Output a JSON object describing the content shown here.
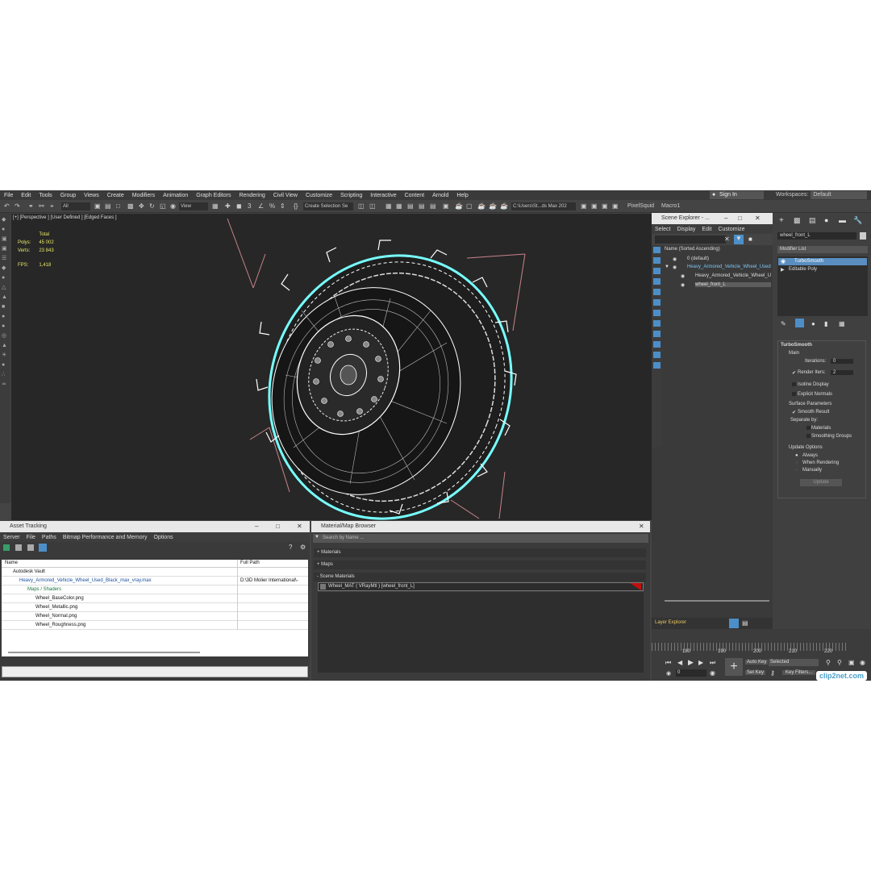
{
  "menu": [
    "File",
    "Edit",
    "Tools",
    "Group",
    "Views",
    "Create",
    "Modifiers",
    "Animation",
    "Graph Editors",
    "Rendering",
    "Civil View",
    "Customize",
    "Scripting",
    "Interactive",
    "Content",
    "Arnold",
    "Help"
  ],
  "signin": "Sign In",
  "workspaces": {
    "label": "Workspaces:",
    "value": "Default"
  },
  "toolbar": {
    "filter": "All",
    "refcoord": "View",
    "selection_set": "Create Selection Se",
    "path": "C:\\Users\\St...ds Max 202",
    "pixelsquid": "PixelSquid",
    "macro": "Macro1"
  },
  "viewport": {
    "label": "[+] [Perspective ] [User Defined ] [Edged Faces ]",
    "stats": {
      "total": "Total",
      "polys_label": "Polys:",
      "polys": "45 002",
      "verts_label": "Verts:",
      "verts": "23 843",
      "fps_label": "FPS:",
      "fps": "1,418"
    }
  },
  "scene_explorer": {
    "title": "Scene Explorer - ...",
    "menu": [
      "Select",
      "Display",
      "Edit",
      "Customize"
    ],
    "sort": "Name (Sorted Ascending)",
    "items": [
      "0 (default)",
      "Heavy_Armored_Vehicle_Wheel_Used",
      "Heavy_Armored_Vehicle_Wheel_U",
      "wheel_front_L"
    ],
    "footer": "Layer Explorer"
  },
  "command_panel": {
    "object_name": "wheel_front_L",
    "modifier_list": "Modifier List",
    "stack": [
      "TurboSmooth",
      "Editable Poly"
    ],
    "rollout": "TurboSmooth",
    "main": "Main",
    "iterations_label": "Iterations:",
    "iterations": "0",
    "render_iters_label": "Render Iters:",
    "render_iters": "2",
    "isoline": "Isoline Display",
    "explicit": "Explicit Normals",
    "surface": "Surface Parameters",
    "smooth": "Smooth Result",
    "separate": "Separate by:",
    "materials": "Materials",
    "smoothing": "Smoothing Groups",
    "update_options": "Update Options",
    "always": "Always",
    "when_rendering": "When Rendering",
    "manually": "Manually",
    "update": "Update"
  },
  "asset_tracking": {
    "title": "Asset Tracking",
    "menu": [
      "Server",
      "File",
      "Paths",
      "Bitmap Performance and Memory",
      "Options"
    ],
    "col_name": "Name",
    "col_path": "Full Path",
    "rows": [
      {
        "name": "Autodesk Vault",
        "path": ""
      },
      {
        "name": "Heavy_Armored_Vehicle_Wheel_Used_Black_max_vray.max",
        "path": "D:\\3D Molier International\\-"
      },
      {
        "name": "Maps / Shaders",
        "path": ""
      },
      {
        "name": "Wheel_BaseColor.png",
        "path": ""
      },
      {
        "name": "Wheel_Metallic.png",
        "path": ""
      },
      {
        "name": "Wheel_Normal.png",
        "path": ""
      },
      {
        "name": "Wheel_Roughness.png",
        "path": ""
      }
    ]
  },
  "material_browser": {
    "title": "Material/Map Browser",
    "search": "Search by Name ...",
    "groups": [
      "+ Materials",
      "+ Maps",
      "- Scene Materials"
    ],
    "item": "Wheel_MAT  ( VRayMtl )  [wheel_front_L]"
  },
  "timeline": {
    "ticks": [
      "180",
      "190",
      "200",
      "210",
      "220"
    ],
    "frame": "0",
    "auto_key": "Auto Key",
    "selected": "Selected",
    "set_key": "Set Key",
    "key_filters": "Key Filters..."
  },
  "watermark": "clip2net.com"
}
